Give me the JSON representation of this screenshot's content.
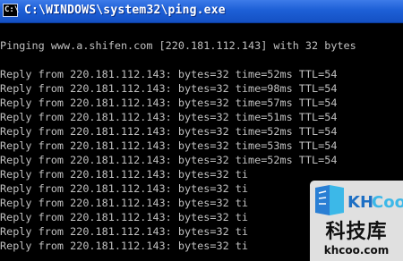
{
  "window": {
    "title": "C:\\WINDOWS\\system32\\ping.exe",
    "icon": "cmd-icon",
    "icon_glyph": "C:\\"
  },
  "console": {
    "lines": [
      "Pinging www.a.shifen.com [220.181.112.143] with 32 bytes",
      "",
      "Reply from 220.181.112.143: bytes=32 time=52ms TTL=54",
      "Reply from 220.181.112.143: bytes=32 time=98ms TTL=54",
      "Reply from 220.181.112.143: bytes=32 time=57ms TTL=54",
      "Reply from 220.181.112.143: bytes=32 time=51ms TTL=54",
      "Reply from 220.181.112.143: bytes=32 time=52ms TTL=54",
      "Reply from 220.181.112.143: bytes=32 time=53ms TTL=54",
      "Reply from 220.181.112.143: bytes=32 time=52ms TTL=54",
      "Reply from 220.181.112.143: bytes=32 ti",
      "Reply from 220.181.112.143: bytes=32 ti",
      "Reply from 220.181.112.143: bytes=32 ti",
      "Reply from 220.181.112.143: bytes=32 ti",
      "Reply from 220.181.112.143: bytes=32 ti",
      "Reply from 220.181.112.143: bytes=32 ti"
    ],
    "text_color": "#c0c0c0",
    "background_color": "#000000"
  },
  "watermark": {
    "logo_text": "KHCOO",
    "chinese_text": "科技库",
    "url_text": "khcoo.com",
    "logo_colors": [
      "#2a7fd4",
      "#3cb8e8"
    ]
  }
}
